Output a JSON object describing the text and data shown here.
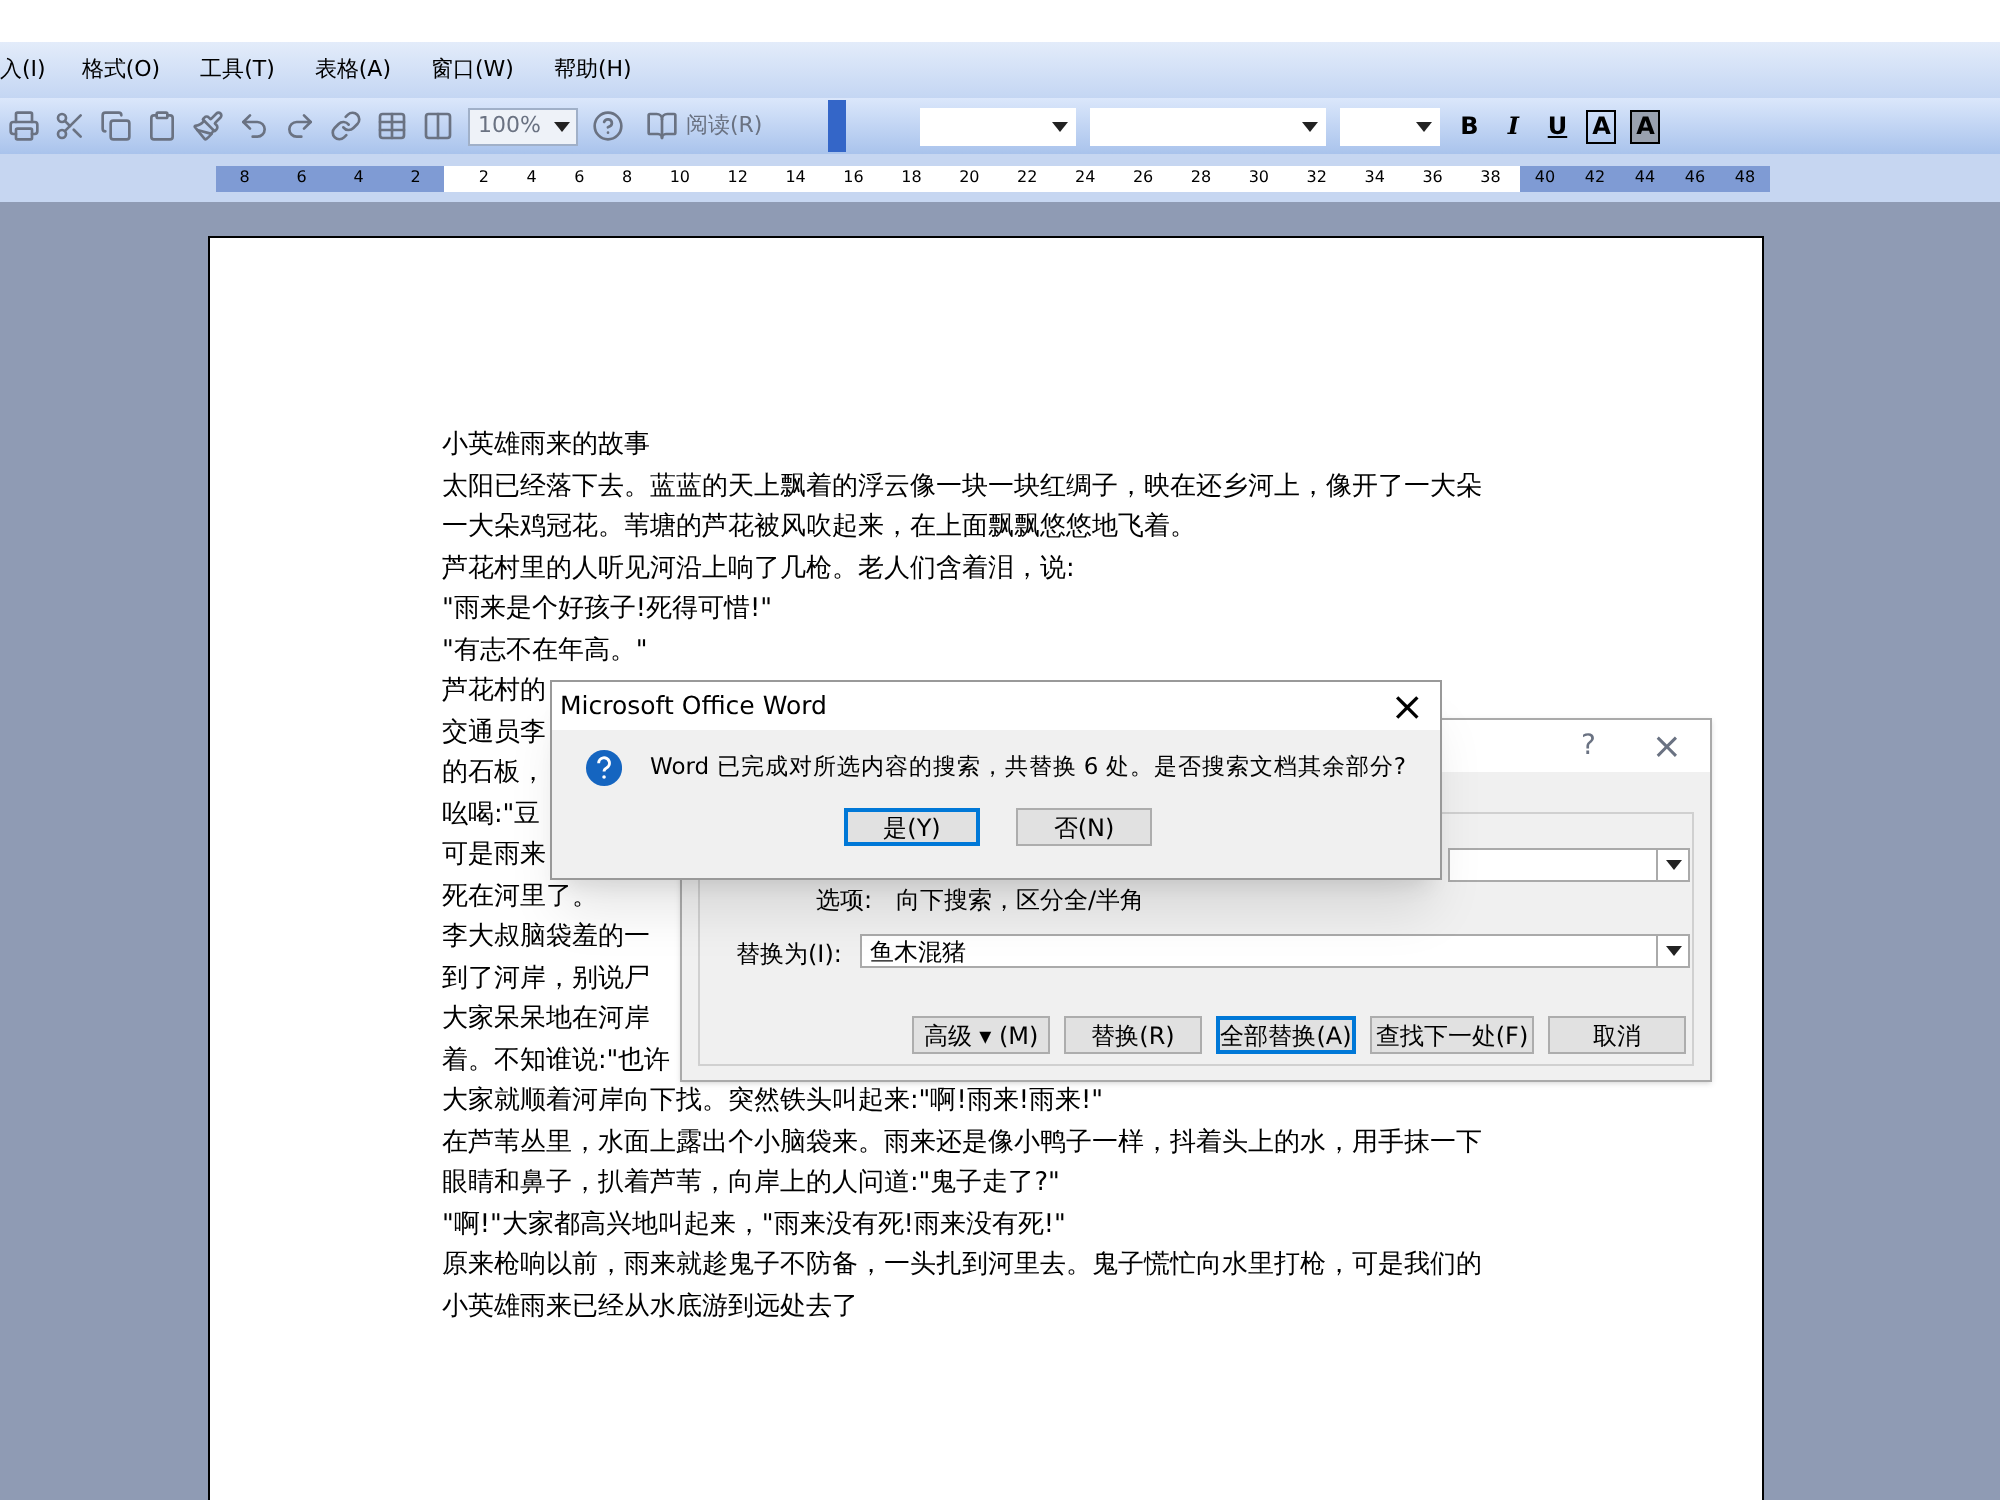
{
  "menu_bar": {
    "items": [
      "入(I)",
      "格式(O)",
      "工具(T)",
      "表格(A)",
      "窗口(W)",
      "帮助(H)"
    ]
  },
  "toolbar": {
    "zoom": "100%",
    "read_button": "阅读(R)",
    "format_buttons": [
      "B",
      "I",
      "U",
      "A",
      "A"
    ]
  },
  "ruler": {
    "left_ticks": [
      "8",
      "6",
      "4",
      "2"
    ],
    "right_ticks": [
      "2",
      "4",
      "6",
      "8",
      "10",
      "12",
      "14",
      "16",
      "18",
      "20",
      "22",
      "24",
      "26",
      "28",
      "30",
      "32",
      "34",
      "36",
      "38",
      "40",
      "42",
      "44",
      "46",
      "48"
    ]
  },
  "document": {
    "lines": [
      {
        "text": "小英雄雨来的故事"
      },
      {
        "text": "太阳已经落下去。蓝蓝的天上飘着的浮云像一块一块红绸子，映在还乡河上，像开了一大朵"
      },
      {
        "text": "一大朵鸡冠花。苇塘的芦花被风吹起来，在上面飘飘悠悠地飞着。"
      },
      {
        "text": "芦花村里的人听见河沿上响了几枪。老人们含着泪，说:"
      },
      {
        "text": "\"雨来是个好孩子!死得可惜!\""
      },
      {
        "text": "\"有志不在年高。\""
      },
      {
        "text": "芦花村的"
      },
      {
        "text": "交通员李"
      },
      {
        "text": "的石板，"
      },
      {
        "text": "吆喝:\"豆"
      },
      {
        "text": "可是雨来"
      },
      {
        "text": "死在河里了。"
      },
      {
        "text": "李大叔脑袋羞的一"
      },
      {
        "text": "到了河岸，别说尸"
      },
      {
        "text": "大家呆呆地在河岸"
      },
      {
        "text": "着。不知谁说:\"也许"
      },
      {
        "text": "大家就顺着河岸向下找。突然铁头叫起来:\"啊!雨来!雨来!\""
      },
      {
        "text": "在芦苇丛里，水面上露出个小脑袋来。雨来还是像小鸭子一样，抖着头上的水，用手抹一下"
      },
      {
        "text": "眼睛和鼻子，扒着芦苇，向岸上的人问道:\"鬼子走了?\""
      },
      {
        "text": "\"啊!\"大家都高兴地叫起来，\"雨来没有死!雨来没有死!\""
      },
      {
        "text": "原来枪响以前，雨来就趁鬼子不防备，一头扎到河里去。鬼子慌忙向水里打枪，可是我们的"
      },
      {
        "text": "小英雄雨来已经从水底游到远处去了"
      }
    ]
  },
  "replace_dialog": {
    "help": "?",
    "close": "×",
    "options_label": "选项:",
    "options_value": "向下搜索，区分全/半角",
    "replace_label": "替换为(I):",
    "replace_value": "鱼木混猪",
    "buttons": [
      {
        "label": "高级 ▾ (M)",
        "selected": false
      },
      {
        "label": "替换(R)",
        "selected": false
      },
      {
        "label": "全部替换(A)",
        "selected": true
      },
      {
        "label": "查找下一处(F)",
        "selected": false
      },
      {
        "label": "取消",
        "selected": false
      }
    ]
  },
  "message_box": {
    "title": "Microsoft Office Word",
    "close": "×",
    "message": "Word 已完成对所选内容的搜索，共替换 6 处。是否搜索文档其余部分?",
    "buttons": [
      {
        "label": "是(Y)",
        "selected": true
      },
      {
        "label": "否(N)",
        "selected": false
      }
    ]
  }
}
